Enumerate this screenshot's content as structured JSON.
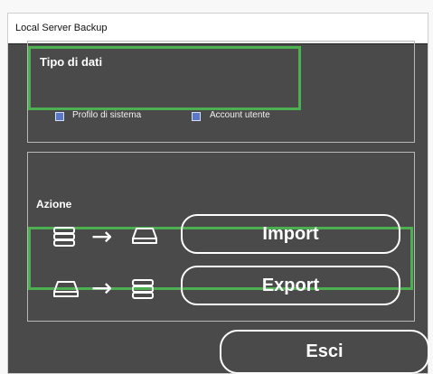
{
  "window": {
    "title": "Local Server Backup"
  },
  "data_section": {
    "title": "Tipo di dati",
    "options": [
      {
        "label": "Profilo di sistema"
      },
      {
        "label": "Account utente"
      }
    ]
  },
  "action_section": {
    "title": "Azione",
    "import_label": "Import",
    "export_label": "Export"
  },
  "footer": {
    "exit_label": "Esci"
  },
  "icons": {
    "server": "server-icon",
    "drive": "drive-icon",
    "arrow": "right-arrow-icon"
  },
  "colors": {
    "highlight": "#4caf50",
    "background": "#4a4a4a",
    "checkbox": "#5a78c7"
  }
}
